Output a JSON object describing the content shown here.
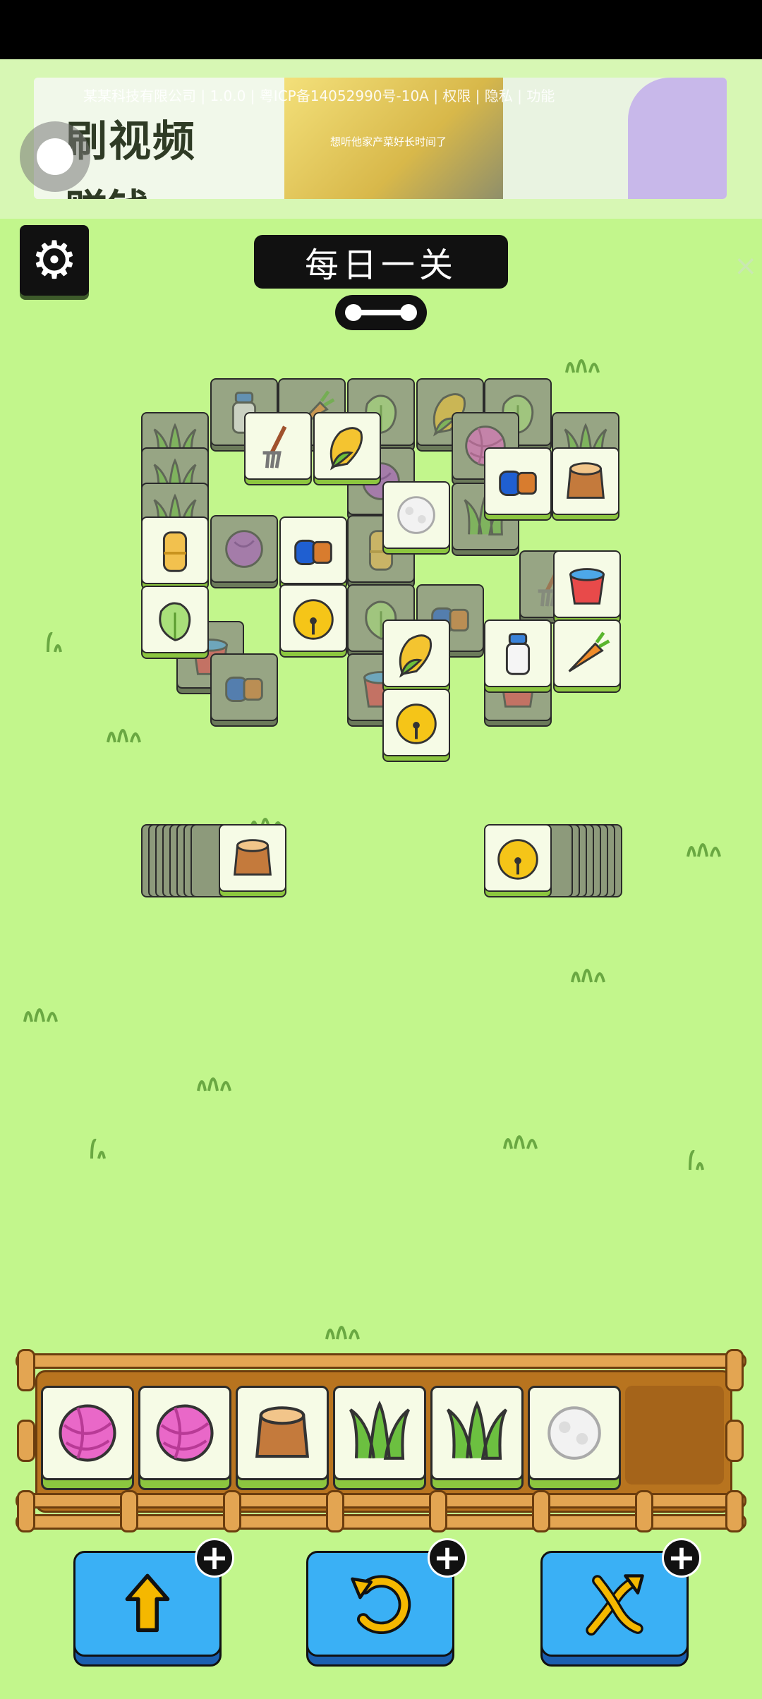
{
  "ad": {
    "headline": "刷视频",
    "headline2": "赚钱",
    "info_line": "某某科技有限公司 | 1.0.0 | 粤ICP备14052990号-10A | 权限 | 隐私 | 功能",
    "caption": "想听他家产菜好长时间了",
    "close_glyph": "×"
  },
  "header": {
    "settings_glyph": "⚙",
    "title": "每日一关"
  },
  "colors": {
    "background": "#c2f68c",
    "tile_face": "#f6fbe6",
    "tile_base": "#8cc63f",
    "blocked_face": "#97a584",
    "tray_wood": "#b8741f",
    "button_blue": "#3ab0f5"
  },
  "side_stacks": {
    "left_top_icon": "stump-icon",
    "right_top_icon": "bell-icon"
  },
  "tray": {
    "slots": [
      "yarn-icon",
      "yarn-icon",
      "stump-icon",
      "grass-icon",
      "grass-icon",
      "cotton-icon"
    ]
  },
  "powerups": [
    {
      "name": "move-out",
      "icon": "move-out-icon",
      "badge": "+"
    },
    {
      "name": "undo",
      "icon": "undo-icon",
      "badge": "+"
    },
    {
      "name": "shuffle",
      "icon": "shuffle-icon",
      "badge": "+"
    }
  ]
}
